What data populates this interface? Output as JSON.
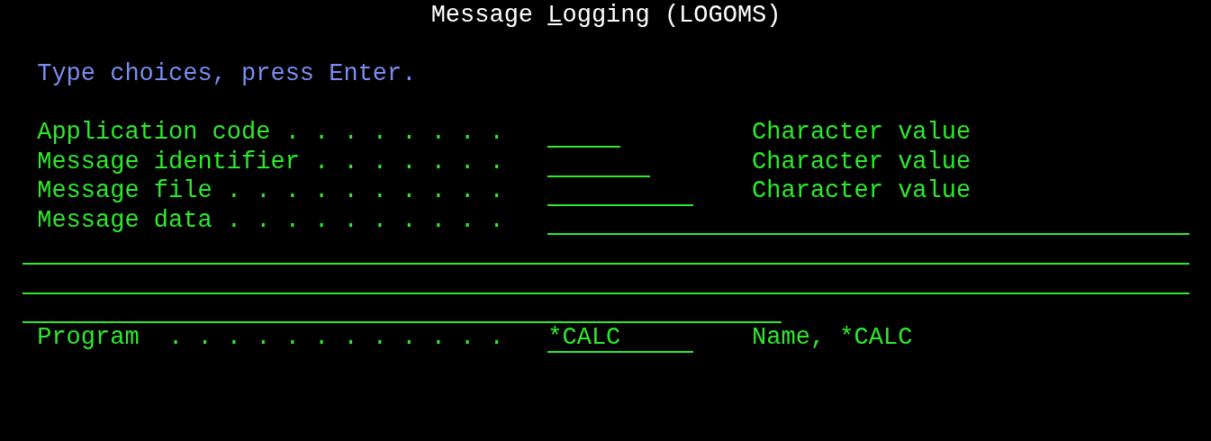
{
  "title": {
    "before": "Message ",
    "key": "L",
    "after": "ogging (LOGOMS)"
  },
  "instruction": "Type choices, press Enter.",
  "fields": [
    {
      "kind": "short",
      "label": "Application code . . . . . . . .",
      "hint": "Character value"
    },
    {
      "kind": "medium",
      "label": "Message identifier . . . . . . .",
      "hint": "Character value"
    },
    {
      "kind": "long",
      "label": "Message file . . . . . . . . . .",
      "hint": "Character value"
    },
    {
      "kind": "multiline",
      "label": "Message data . . . . . . . . . ."
    },
    {
      "kind": "long",
      "label": "Program  . . . . . . . . . . . .",
      "value": "*CALC",
      "hint": "Name, *CALC"
    }
  ]
}
